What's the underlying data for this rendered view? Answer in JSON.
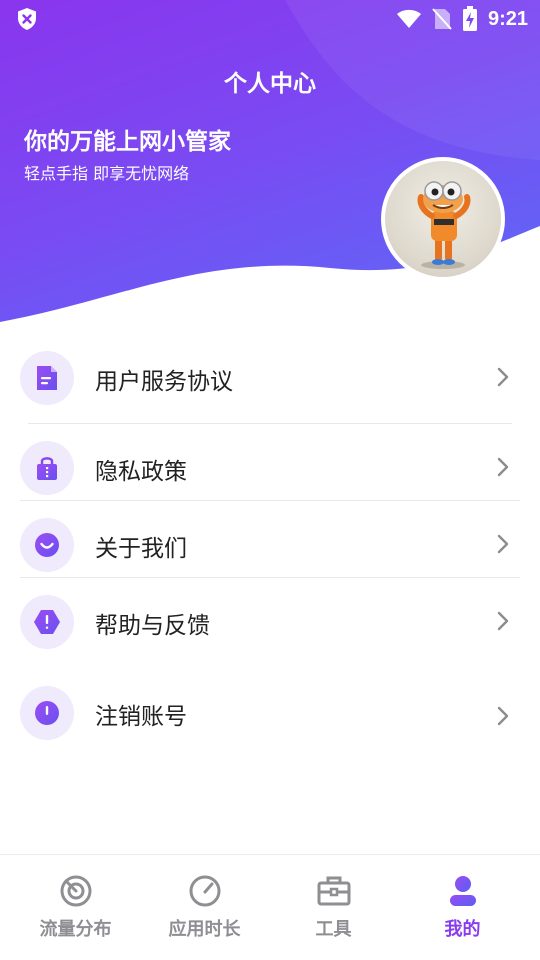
{
  "status_bar": {
    "time": "9:21"
  },
  "header": {
    "title": "个人中心",
    "slogan": "你的万能上网小管家",
    "subslogan": "轻点手指 即享无忧网络"
  },
  "menu": [
    {
      "label": "用户服务协议",
      "icon": "document-icon"
    },
    {
      "label": "隐私政策",
      "icon": "lock-bag-icon"
    },
    {
      "label": "关于我们",
      "icon": "smile-icon"
    },
    {
      "label": "帮助与反馈",
      "icon": "alert-hexagon-icon"
    },
    {
      "label": "注销账号",
      "icon": "power-icon"
    }
  ],
  "tabs": [
    {
      "label": "流量分布",
      "icon": "radar-icon",
      "active": false
    },
    {
      "label": "应用时长",
      "icon": "gauge-icon",
      "active": false
    },
    {
      "label": "工具",
      "icon": "toolbox-icon",
      "active": false
    },
    {
      "label": "我的",
      "icon": "person-icon",
      "active": true
    }
  ],
  "colors": {
    "accent": "#8a3cf0",
    "header_start": "#8a35ee",
    "header_end": "#5a6cf8",
    "icon_bg": "#efeafc"
  }
}
